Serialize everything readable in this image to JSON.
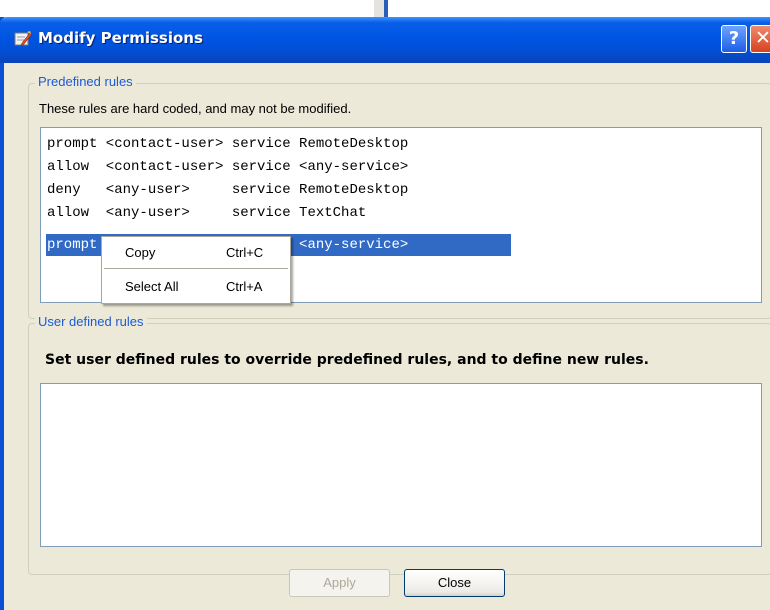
{
  "window": {
    "title": "Modify Permissions",
    "help_label": "?",
    "close_label": "✕"
  },
  "predefined": {
    "legend": "Predefined rules",
    "description": "These rules are hard coded, and may not be modified.",
    "rules": [
      "prompt <contact-user> service RemoteDesktop",
      "allow  <contact-user> service <any-service>",
      "deny   <any-user>     service RemoteDesktop",
      "allow  <any-user>     service TextChat",
      "prompt <any-user>     service <any-service>"
    ],
    "selected_index": 4
  },
  "context_menu": {
    "items": [
      {
        "label": "Copy",
        "shortcut": "Ctrl+C"
      },
      {
        "label": "Select All",
        "shortcut": "Ctrl+A"
      }
    ]
  },
  "user_defined": {
    "legend": "User defined rules",
    "instruction": "Set user defined rules to override predefined rules, and to define new rules.",
    "rules": []
  },
  "buttons": {
    "apply": "Apply",
    "close": "Close"
  },
  "colors": {
    "title_bar": "#0054e3",
    "selection": "#316ac5",
    "legend_text": "#1c5ad6"
  }
}
